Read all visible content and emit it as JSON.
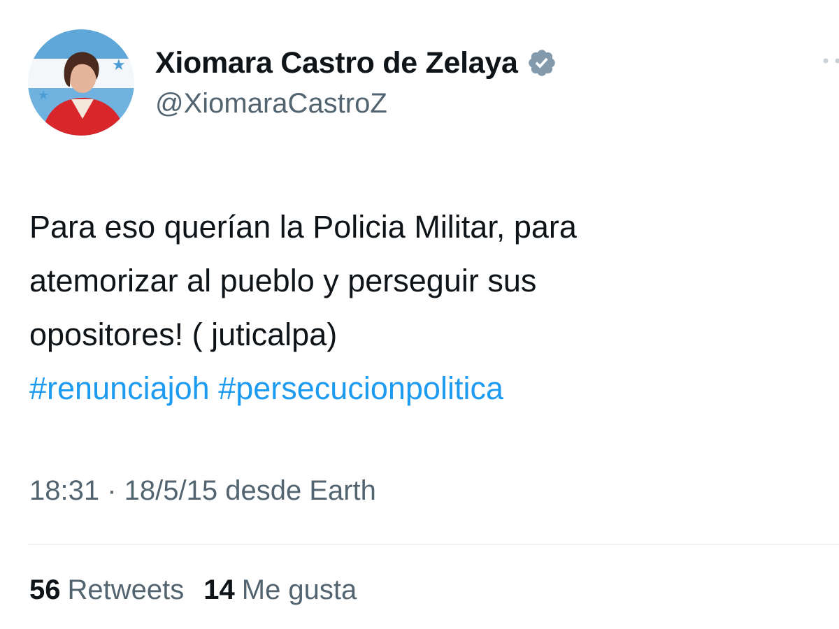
{
  "author": {
    "display_name": "Xiomara Castro de Zelaya",
    "handle": "@XiomaraCastroZ",
    "verified_icon": "verified-badge-icon",
    "verified_color": "#829aab"
  },
  "tweet": {
    "lines": [
      "Para eso querían la Policia Militar, para",
      "atemorizar al pueblo y perseguir sus",
      "opositores! ( juticalpa)"
    ],
    "hashtags": [
      "#renunciajoh",
      "#persecucionpolitica"
    ],
    "meta": "18:31 · 18/5/15 desde Earth"
  },
  "stats": {
    "retweets_count": "56",
    "retweets_label": "Retweets",
    "likes_count": "14",
    "likes_label": "Me gusta"
  },
  "colors": {
    "text": "#0f1419",
    "secondary": "#536471",
    "link": "#1d9bf0",
    "divider": "#eff3f4"
  }
}
